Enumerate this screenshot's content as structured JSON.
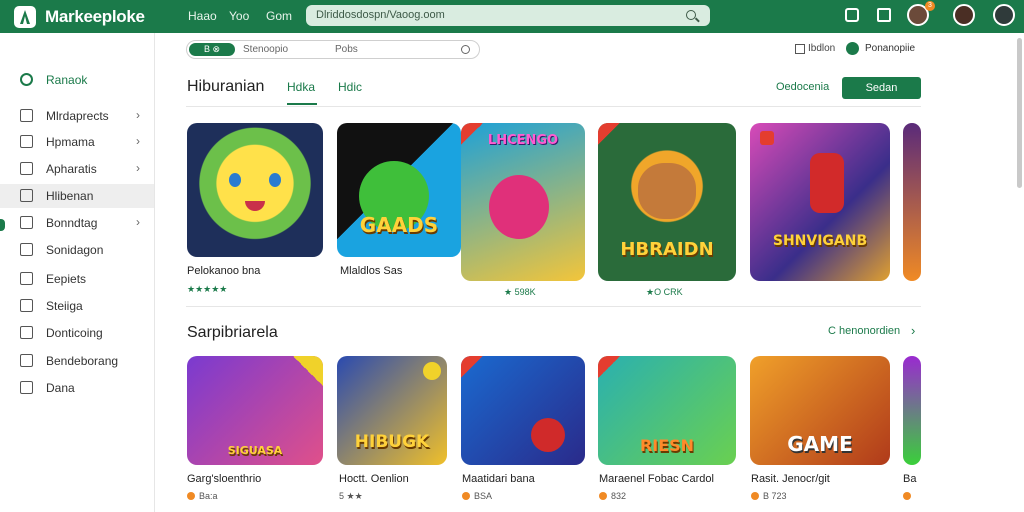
{
  "topbar": {
    "app_title": "Markeeploke",
    "nav": [
      "Haao",
      "Yoo",
      "Gom"
    ],
    "search_text": "Dlriddosdospn/Vaoog.oom",
    "notification_count": "3"
  },
  "sidebar": {
    "home": "Ranaok",
    "items": [
      {
        "label": "Mlrdaprects",
        "chevron": true
      },
      {
        "label": "Hpmama",
        "chevron": true
      },
      {
        "label": "Apharatis",
        "chevron": true
      },
      {
        "label": "Hlibenan",
        "chevron": false,
        "active": true
      },
      {
        "label": "Bonndtag",
        "chevron": true
      },
      {
        "label": "Sonidagon",
        "chevron": false
      },
      {
        "label": "Eepiets",
        "chevron": false
      },
      {
        "label": "Steiiga",
        "chevron": false
      },
      {
        "label": "Donticoing",
        "chevron": false
      },
      {
        "label": "Bendeborang",
        "chevron": false
      },
      {
        "label": "Dana",
        "chevron": false
      }
    ]
  },
  "filterbar": {
    "pill": "B ⊗",
    "text1": "Stenoopio",
    "text2": "Pobs"
  },
  "options": {
    "check_label": "Ibdlon",
    "badge_label": "Ponanopiie"
  },
  "section1": {
    "title": "Hiburanian",
    "tabs": [
      "Hdka",
      "Hdic"
    ],
    "link": "Oedocenia",
    "cta": "Sedan",
    "cards": [
      {
        "title": "Pelokanoo bna",
        "meta": "★★★★★",
        "art": ""
      },
      {
        "title": "Mlaldlos Sas",
        "meta": "",
        "art": "GAADS"
      },
      {
        "title": "",
        "meta": "★ 598K",
        "art": "LHCENGO"
      },
      {
        "title": "",
        "meta": "★O CRK",
        "art": "HBRAIDN"
      },
      {
        "title": "",
        "meta": "",
        "art": "SHNVIGANB"
      }
    ]
  },
  "section2": {
    "title": "Sarpibriarela",
    "link": "C henonordien",
    "cards": [
      {
        "title": "Garg'sloenthrio",
        "meta": "Ba:a",
        "art": "SIGUASA"
      },
      {
        "title": "Hoctt. Oenlion",
        "meta": "5 ★★",
        "art": "HIBUGK"
      },
      {
        "title": "Maatidari bana",
        "meta": "BSA",
        "art": ""
      },
      {
        "title": "Maraenel Fobac Cardol",
        "meta": "832",
        "art": "RIESN"
      },
      {
        "title": "Rasit. Jenocr/git",
        "meta": "B 723",
        "art": "GAME"
      },
      {
        "title": "Ba",
        "meta": "",
        "art": ""
      }
    ]
  },
  "colors": {
    "brand": "#1b7a4a",
    "accent_orange": "#f08a24"
  }
}
